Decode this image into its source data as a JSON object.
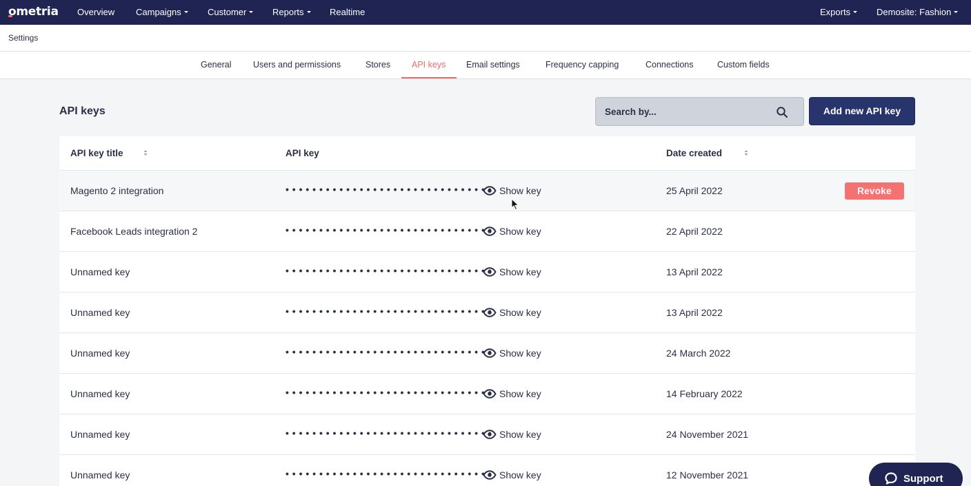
{
  "brand": {
    "logo": "ometria"
  },
  "topnav": {
    "items": [
      {
        "label": "Overview",
        "dropdown": false
      },
      {
        "label": "Campaigns",
        "dropdown": true
      },
      {
        "label": "Customer",
        "dropdown": true
      },
      {
        "label": "Reports",
        "dropdown": true
      },
      {
        "label": "Realtime",
        "dropdown": false
      }
    ],
    "right": [
      {
        "label": "Exports",
        "dropdown": true
      },
      {
        "label": "Demosite: Fashion",
        "dropdown": true
      }
    ]
  },
  "settings": {
    "title": "Settings"
  },
  "tabs": [
    {
      "label": "General"
    },
    {
      "label": "Users and permissions"
    },
    {
      "label": "Stores"
    },
    {
      "label": "API keys",
      "active": true
    },
    {
      "label": "Email settings"
    },
    {
      "label": "Frequency capping"
    },
    {
      "label": "Connections"
    },
    {
      "label": "Custom fields"
    }
  ],
  "page": {
    "title": "API keys",
    "search_placeholder": "Search by...",
    "add_button": "Add new API key"
  },
  "table": {
    "columns": {
      "title": "API key title",
      "key": "API key",
      "date": "Date created"
    },
    "masked_key": "• • • • • • • • • • • • • • • • • • • • • • • • • • • • • • •",
    "show_key_label": "Show key",
    "revoke_label": "Revoke",
    "rows": [
      {
        "title": "Magento 2 integration",
        "date": "25 April 2022"
      },
      {
        "title": "Facebook Leads integration 2",
        "date": "22 April 2022"
      },
      {
        "title": "Unnamed key",
        "date": "13 April 2022"
      },
      {
        "title": "Unnamed key",
        "date": "13 April 2022"
      },
      {
        "title": "Unnamed key",
        "date": "24 March 2022"
      },
      {
        "title": "Unnamed key",
        "date": "14 February 2022"
      },
      {
        "title": "Unnamed key",
        "date": "24 November 2021"
      },
      {
        "title": "Unnamed key",
        "date": "12 November 2021"
      }
    ]
  },
  "support": {
    "label": "Support"
  },
  "colors": {
    "nav_bg": "#1f2452",
    "accent": "#f06a6a",
    "primary_button": "#28356c",
    "revoke": "#f47272"
  }
}
